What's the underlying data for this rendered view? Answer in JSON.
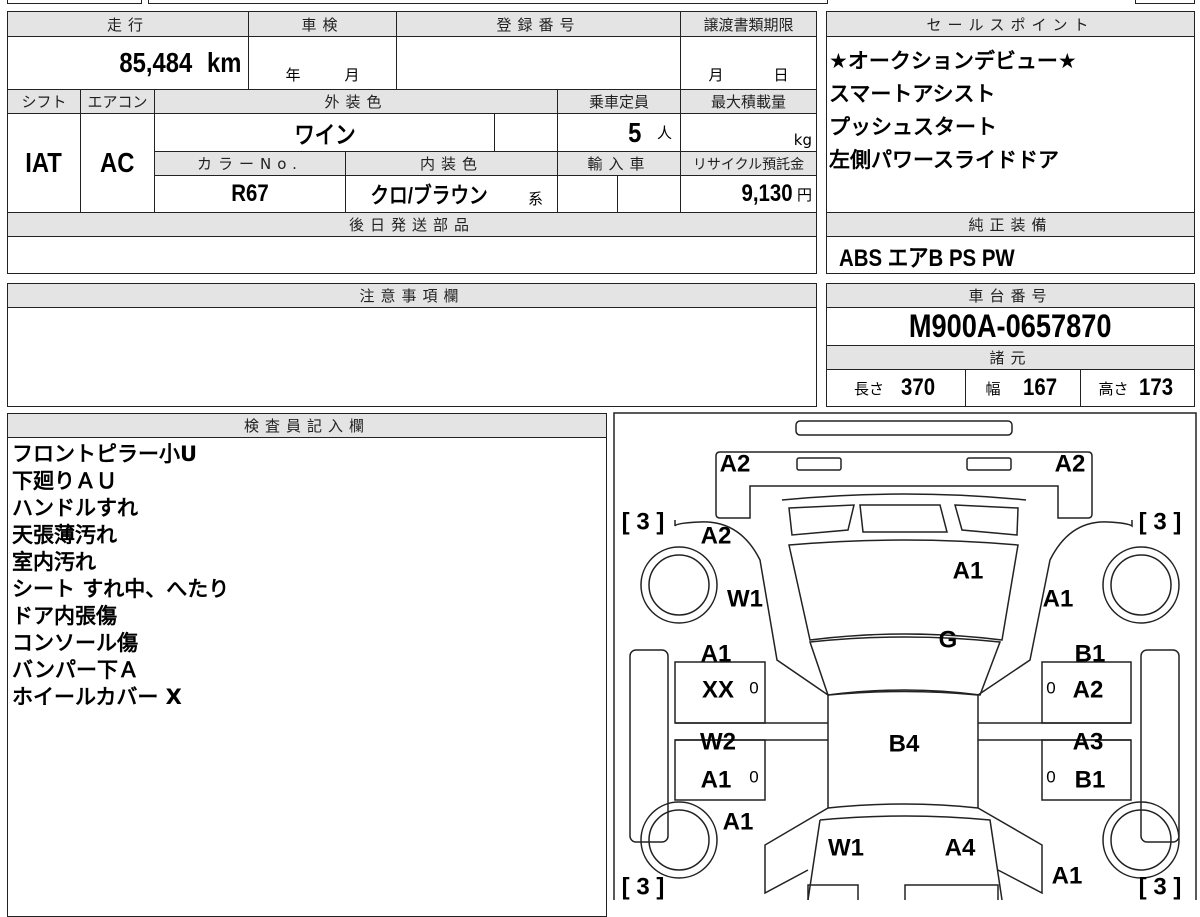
{
  "vehicle": {
    "mileage_label": "走行",
    "mileage": "85,484",
    "mileage_unit": "km",
    "inspection_label": "車検",
    "inspection_year": "年",
    "inspection_month": "月",
    "registration_label": "登録番号",
    "registration": "",
    "transfer_label": "譲渡書類期限",
    "transfer_month": "月",
    "transfer_day": "日",
    "shift_label": "シフト",
    "shift": "IAT",
    "ac_label": "エアコン",
    "ac": "AC",
    "exterior_label": "外装色",
    "exterior": "ワイン",
    "capacity_label": "乗車定員",
    "capacity": "5",
    "capacity_unit": "人",
    "load_label": "最大積載量",
    "load_unit": "kg",
    "colorno_label": "カラーNo.",
    "colorno": "R67",
    "interior_label": "内装色",
    "interior": "クロ/ブラウン",
    "interior_suffix": "系",
    "import_label": "輸入車",
    "recycle_label": "リサイクル預託金",
    "recycle": "9,130",
    "recycle_unit": "円",
    "later_parts_label": "後日発送部品"
  },
  "sales": {
    "label": "セールスポイント",
    "items": [
      "★オークションデビュー★",
      "スマートアシスト",
      "プッシュスタート",
      "左側パワースライドドア"
    ]
  },
  "equipment": {
    "label": "純正装備",
    "value": "ABS エアB PS PW"
  },
  "notes": {
    "label": "注意事項欄"
  },
  "chassis": {
    "label": "車台番号",
    "value": "M900A-0657870",
    "spec_label": "諸元",
    "length_label": "長さ",
    "length": "370",
    "width_label": "幅",
    "width": "167",
    "height_label": "高さ",
    "height": "173"
  },
  "inspector": {
    "label": "検査員記入欄",
    "items": [
      "フロントピラー小U",
      "下廻りＡＵ",
      "ハンドルすれ",
      "天張薄汚れ",
      "室内汚れ",
      "シート すれ中、へたり",
      "ドア内張傷",
      "コンソール傷",
      "バンパー下Ａ",
      "ホイールカバー X"
    ]
  },
  "diagram": {
    "marks": [
      "A2",
      "A2",
      "[ 3 ]",
      "[ 3 ]",
      "A2",
      "A1",
      "W1",
      "A1",
      "G",
      "A1",
      "B1",
      "XX",
      "0",
      "0",
      "A2",
      "W2",
      "B4",
      "A3",
      "A1",
      "0",
      "0",
      "B1",
      "A1",
      "W1",
      "A4",
      "A1",
      "[ 3 ]",
      "[ 3 ]"
    ]
  }
}
